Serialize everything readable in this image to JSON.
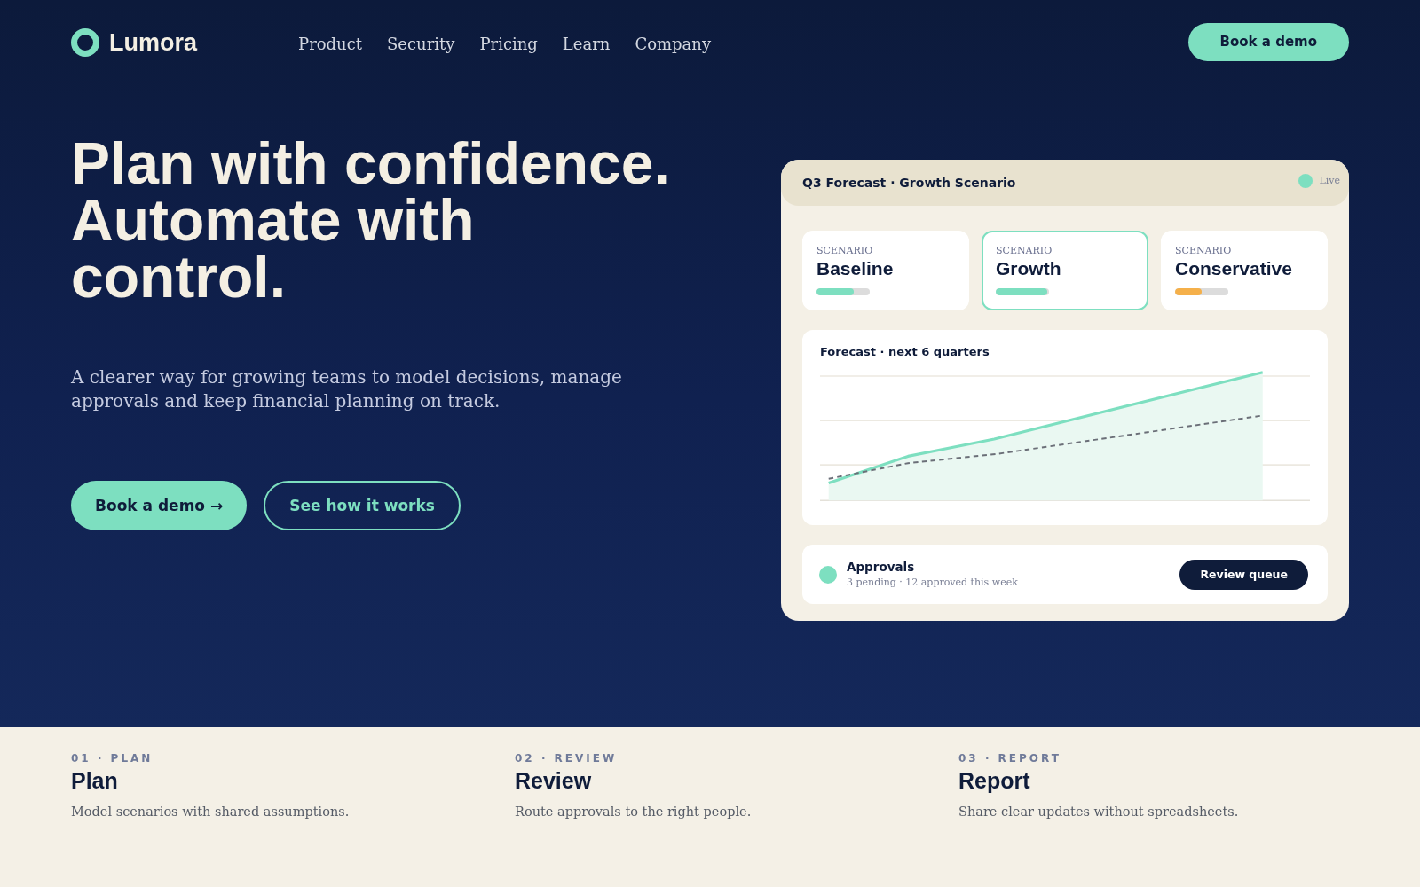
{
  "header": {
    "logo": "Lumora",
    "nav": [
      "Product",
      "Security",
      "Pricing",
      "Learn",
      "Company"
    ],
    "cta": "Book a demo"
  },
  "hero": {
    "headline": "Plan with confidence. Automate with control.",
    "subtitle": "A clearer way for growing teams to model decisions, manage approvals and keep financial planning on track.",
    "buttons": [
      {
        "label": "Book a demo →",
        "kind": "primary"
      },
      {
        "label": "See how it works",
        "kind": "secondary"
      }
    ]
  },
  "forecast_card": {
    "title": "Q3 Forecast · Growth Scenario",
    "status": "Live",
    "scenarios": [
      {
        "eyebrow": "SCENARIO",
        "name": "Baseline",
        "level": 0.7,
        "color": "#7ddfc0",
        "selected": false
      },
      {
        "eyebrow": "SCENARIO",
        "name": "Growth",
        "level": 0.96,
        "color": "#7ddfc0",
        "selected": true
      },
      {
        "eyebrow": "SCENARIO",
        "name": "Conservative",
        "level": 0.5,
        "color": "#f5b04a",
        "selected": false
      }
    ],
    "chart": {
      "title": "Forecast · next 6 quarters"
    },
    "approvals": {
      "title": "Approvals",
      "summary": "3 pending · 12 approved this week",
      "button": "Review queue"
    }
  },
  "steps": [
    {
      "eyebrow": "01 · PLAN",
      "title": "Plan",
      "description": "Model scenarios with shared assumptions."
    },
    {
      "eyebrow": "02 · REVIEW",
      "title": "Review",
      "description": "Route approvals to the right people."
    },
    {
      "eyebrow": "03 · REPORT",
      "title": "Report",
      "description": "Share clear updates without spreadsheets."
    }
  ]
}
